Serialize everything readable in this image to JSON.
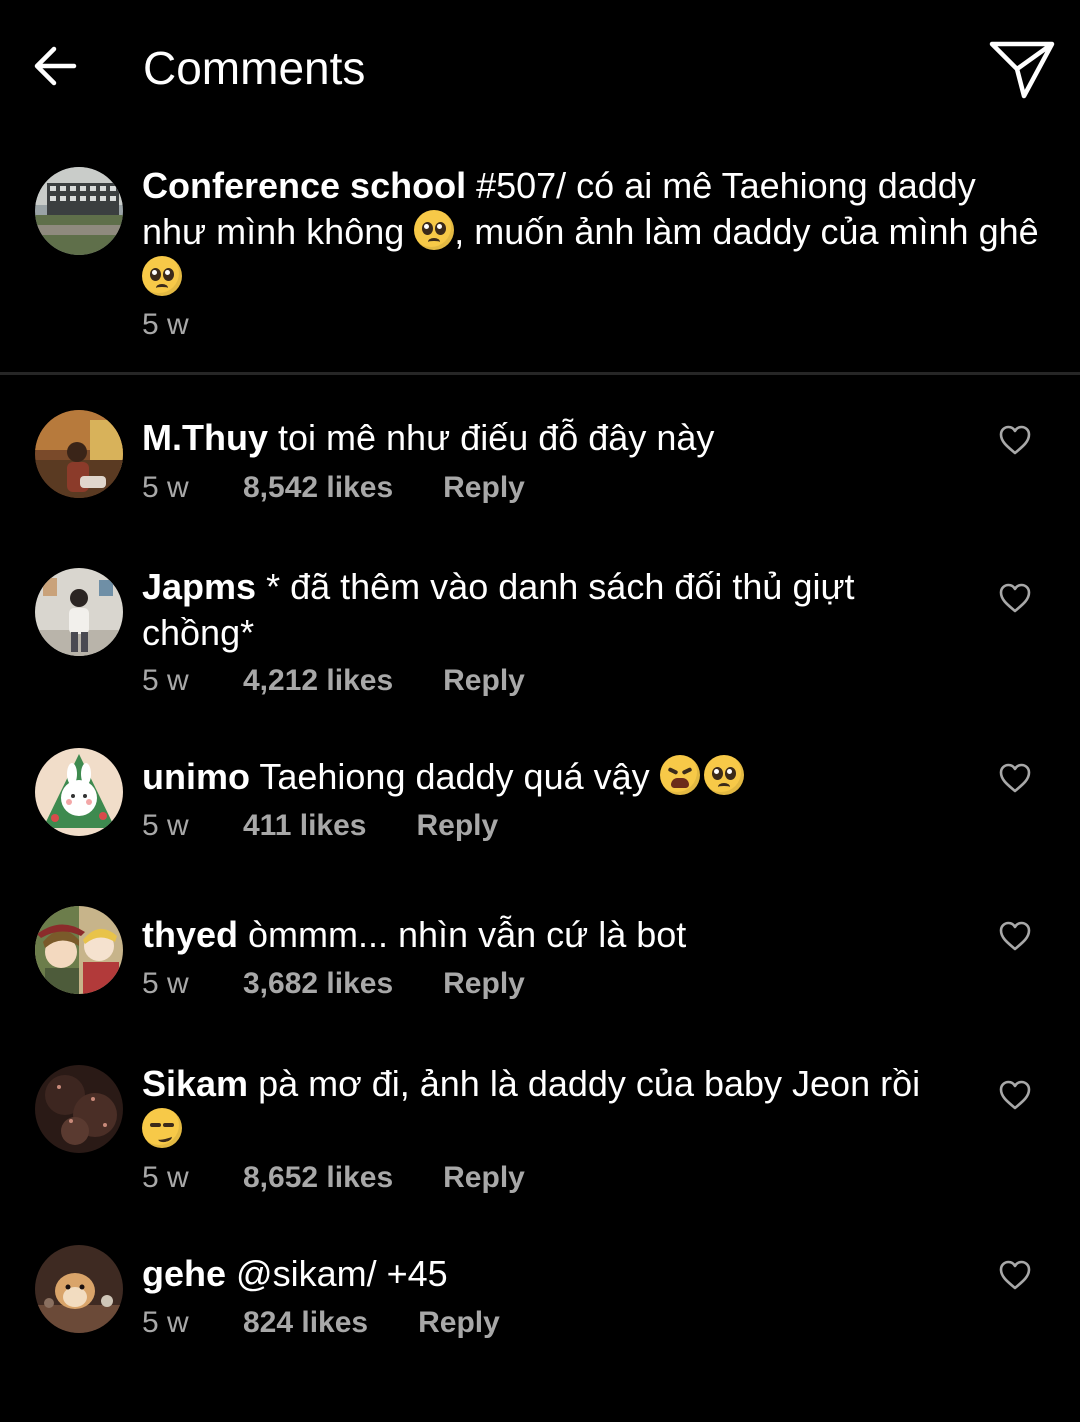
{
  "header": {
    "title": "Comments",
    "back_icon": "arrow-left-icon",
    "send_icon": "paper-plane-icon"
  },
  "caption": {
    "username": "Conference school",
    "text_parts": [
      " #507/ có ai mê Taehiong daddy như mình không ",
      ", muốn ảnh làm daddy của mình ghê "
    ],
    "time": "5 w"
  },
  "comments": [
    {
      "username": "M.Thuy",
      "text": " toi mê như điếu đỗ đây này",
      "time": "5 w",
      "likes": "8,542 likes",
      "reply": "Reply"
    },
    {
      "username": "Japms",
      "text": " * đã thêm vào danh sách đối thủ giựt chồng*",
      "time": "5 w",
      "likes": "4,212 likes",
      "reply": "Reply"
    },
    {
      "username": "unimo",
      "text": " Taehiong daddy quá vậy ",
      "time": "5 w",
      "likes": "411 likes",
      "reply": "Reply"
    },
    {
      "username": "thyed",
      "text": " òmmm... nhìn vẫn cứ là bot",
      "time": "5 w",
      "likes": "3,682 likes",
      "reply": "Reply"
    },
    {
      "username": "Sikam",
      "text": " pà mơ đi, ảnh là daddy của baby Jeon rồi ",
      "time": "5 w",
      "likes": "8,652 likes",
      "reply": "Reply"
    },
    {
      "username": "gehe",
      "text": " @sikam/ +45",
      "time": "5 w",
      "likes": "824 likes",
      "reply": "Reply"
    }
  ],
  "colors": {
    "background": "#000000",
    "text": "#ffffff",
    "meta": "#a8a8a8",
    "divider": "#262626"
  }
}
